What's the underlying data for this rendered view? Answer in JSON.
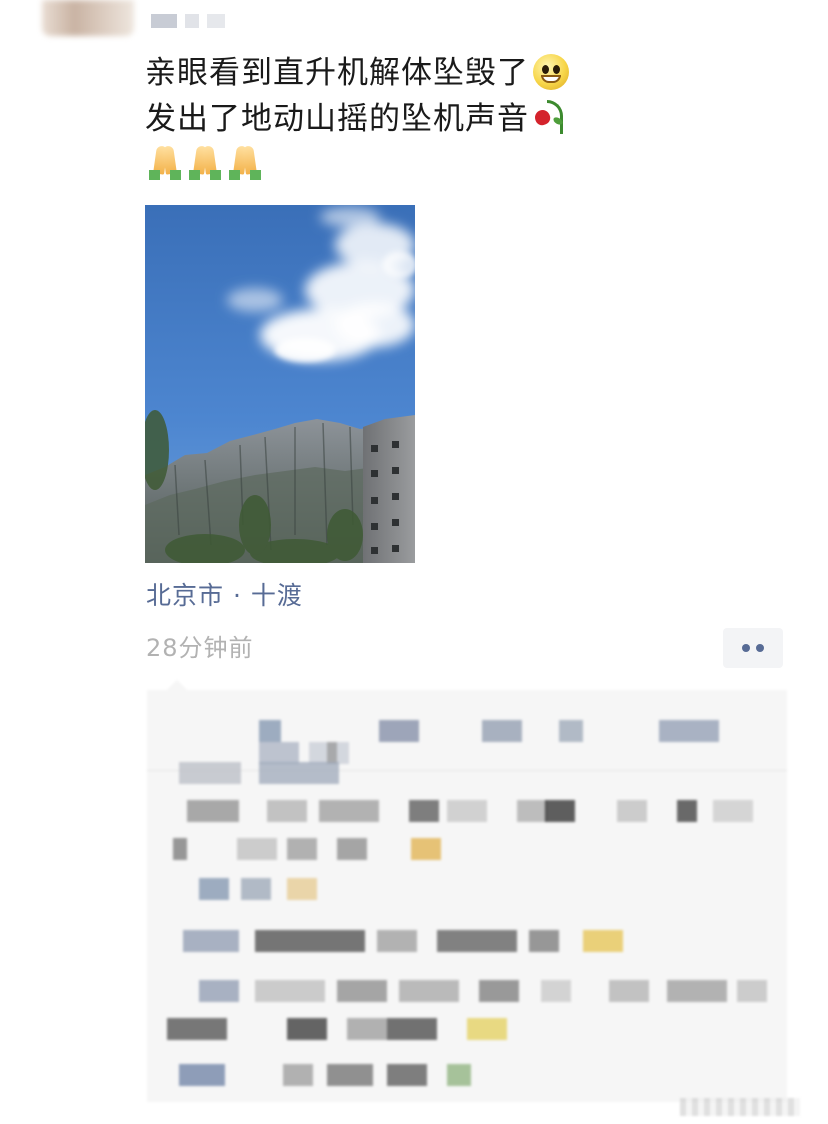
{
  "post": {
    "line1": "亲眼看到直升机解体坠毁了",
    "line2": "发出了地动山摇的坠机声音",
    "emoji_line1": "grin-icon",
    "emoji_line2": "wilted-rose-icon",
    "pray_emojis": [
      "pray-icon",
      "pray-icon",
      "pray-icon"
    ]
  },
  "location": "北京市 · 十渡",
  "timestamp": "28分钟前",
  "more_button": "more-dots-icon",
  "colors": {
    "text": "#1a1a1a",
    "link": "#576b95",
    "meta": "#b2b2b2",
    "comments_bg": "#f6f6f6"
  }
}
